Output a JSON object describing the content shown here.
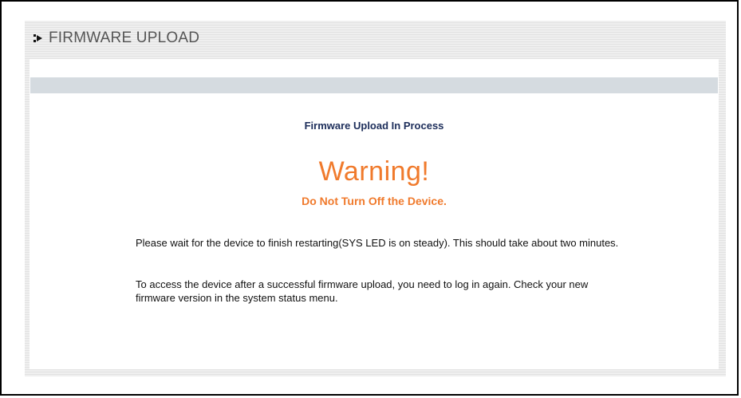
{
  "page": {
    "title": "FIRMWARE UPLOAD",
    "icon": "arrow-right-icon"
  },
  "status": {
    "heading": "Firmware Upload In Process"
  },
  "warning": {
    "title": "Warning!",
    "subtitle": "Do Not Turn Off the Device."
  },
  "messages": [
    "Please wait for the device to finish restarting(SYS LED is on steady). This should take about two minutes.",
    "To access the device after a successful firmware upload, you need to log in again. Check your new firmware version in the system status menu."
  ],
  "colors": {
    "warning": "#f07a2c",
    "heading": "#1c2d5a",
    "bar": "#d5dbe0"
  }
}
